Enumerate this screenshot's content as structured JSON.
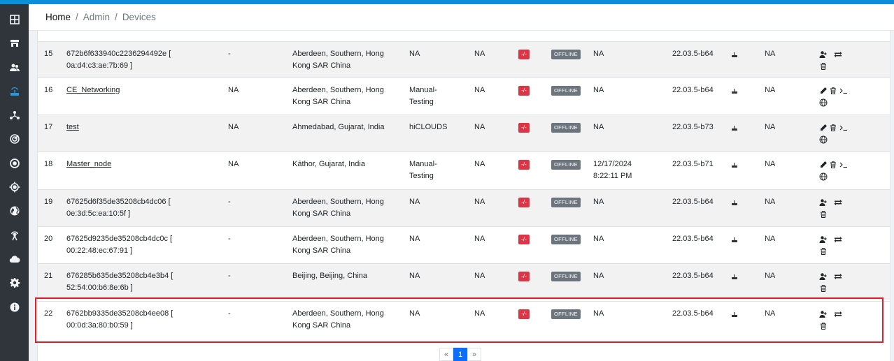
{
  "breadcrumb": {
    "home": "Home",
    "sep": "/",
    "admin": "Admin",
    "devices": "Devices"
  },
  "sidebar_icons": [
    "dashboard-icon",
    "store-icon",
    "users-icon",
    "router-icon",
    "network-icon",
    "radar-icon",
    "target-icon",
    "crosshair-icon",
    "globe-icon",
    "antenna-icon",
    "cloud-icon",
    "gear-icon",
    "info-icon"
  ],
  "rows": [
    {
      "num": "15",
      "name": "672b6f633940c2236294492e [",
      "name2": "0a:d4:c3:ae:7b:69 ]",
      "linked": false,
      "col3": "-",
      "loc": "Aberdeen, Southern, Hong",
      "loc2": "Kong SAR China",
      "group": "NA",
      "group2": "",
      "c5": "NA",
      "status_text": "-/-",
      "state": "OFFLINE",
      "last_seen": "NA",
      "last_seen2": "",
      "fw": "22.03.5-b64",
      "extra": "NA",
      "actions": "claim"
    },
    {
      "num": "16",
      "name": "CE_Networking",
      "name2": "",
      "linked": true,
      "col3": "NA",
      "loc": "Aberdeen, Southern, Hong",
      "loc2": "Kong SAR China",
      "group": "Manual-",
      "group2": "Testing",
      "c5": "NA",
      "status_text": "-/-",
      "state": "OFFLINE",
      "last_seen": "NA",
      "last_seen2": "",
      "fw": "22.03.5-b64",
      "extra": "NA",
      "actions": "edit"
    },
    {
      "num": "17",
      "name": "test",
      "name2": "",
      "linked": true,
      "col3": "NA",
      "loc": "Ahmedabad, Gujarat, India",
      "loc2": "",
      "group": "hiCLOUDS",
      "group2": "",
      "c5": "NA",
      "status_text": "-/-",
      "state": "OFFLINE",
      "last_seen": "NA",
      "last_seen2": "",
      "fw": "22.03.5-b73",
      "extra": "NA",
      "actions": "edit"
    },
    {
      "num": "18",
      "name": "Master_node",
      "name2": "",
      "linked": true,
      "col3": "NA",
      "loc": "Kāthor, Gujarat, India",
      "loc2": "",
      "group": "Manual-",
      "group2": "Testing",
      "c5": "NA",
      "status_text": "-/-",
      "state": "OFFLINE",
      "last_seen": "12/17/2024",
      "last_seen2": "8:22:11 PM",
      "fw": "22.03.5-b71",
      "extra": "NA",
      "actions": "edit"
    },
    {
      "num": "19",
      "name": "67625d6f35de35208cb4dc06 [",
      "name2": "0e:3d:5c:ea:10:5f ]",
      "linked": false,
      "col3": "-",
      "loc": "Aberdeen, Southern, Hong",
      "loc2": "Kong SAR China",
      "group": "NA",
      "group2": "",
      "c5": "NA",
      "status_text": "-/-",
      "state": "OFFLINE",
      "last_seen": "NA",
      "last_seen2": "",
      "fw": "22.03.5-b64",
      "extra": "NA",
      "actions": "claim"
    },
    {
      "num": "20",
      "name": "67625d9235de35208cb4dc0c [",
      "name2": "00:22:48:ec:67:91 ]",
      "linked": false,
      "col3": "-",
      "loc": "Aberdeen, Southern, Hong",
      "loc2": "Kong SAR China",
      "group": "NA",
      "group2": "",
      "c5": "NA",
      "status_text": "-/-",
      "state": "OFFLINE",
      "last_seen": "NA",
      "last_seen2": "",
      "fw": "22.03.5-b64",
      "extra": "NA",
      "actions": "claim"
    },
    {
      "num": "21",
      "name": "676285b635de35208cb4e3b4 [",
      "name2": "52:54:00:b6:8e:6b ]",
      "linked": false,
      "col3": "-",
      "loc": "Beijing, Beijing, China",
      "loc2": "",
      "group": "NA",
      "group2": "",
      "c5": "NA",
      "status_text": "-/-",
      "state": "OFFLINE",
      "last_seen": "NA",
      "last_seen2": "",
      "fw": "22.03.5-b64",
      "extra": "NA",
      "actions": "claim"
    },
    {
      "num": "22",
      "name": "6762bb9335de35208cb4ee08 [",
      "name2": "00:0d:3a:80:b0:59 ]",
      "linked": false,
      "col3": "-",
      "loc": "Aberdeen, Southern, Hong",
      "loc2": "Kong SAR China",
      "group": "NA",
      "group2": "",
      "c5": "NA",
      "status_text": "-/-",
      "state": "OFFLINE",
      "last_seen": "NA",
      "last_seen2": "",
      "fw": "22.03.5-b64",
      "extra": "NA",
      "actions": "claim"
    }
  ],
  "pagination": {
    "prev": "«",
    "current": "1",
    "next": "»"
  },
  "colors": {
    "accent": "#0a8fd8",
    "sidebar": "#2f353a",
    "danger": "#dc3545",
    "offline": "#6c757d",
    "highlight": "#e01e2b"
  }
}
